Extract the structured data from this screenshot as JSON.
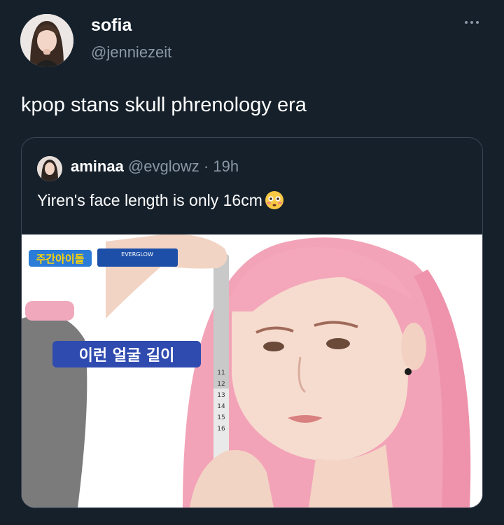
{
  "tweet": {
    "author_name": "sofia",
    "author_handle": "@jenniezeit",
    "more_icon": "more-horizontal-icon",
    "text": "kpop stans skull phrenology era"
  },
  "quote": {
    "author_name": "aminaa",
    "author_handle": "@evglowz",
    "separator": "·",
    "time": "19h",
    "text": "Yiren's face length is only 16cm",
    "emoji": "flushed-face-emoji"
  },
  "media": {
    "logo_text": "주간아이돌",
    "badge_line1": "EVERGLOW",
    "caption": "이런 얼굴 길이",
    "tape_numbers": [
      "11",
      "12",
      "13",
      "14",
      "15",
      "16"
    ]
  },
  "colors": {
    "background": "#15202b",
    "secondary_text": "#8b98a5",
    "border": "#3a4753",
    "hair_pink": "#f3a3b8",
    "caption_blue": "#2f4bb0"
  }
}
